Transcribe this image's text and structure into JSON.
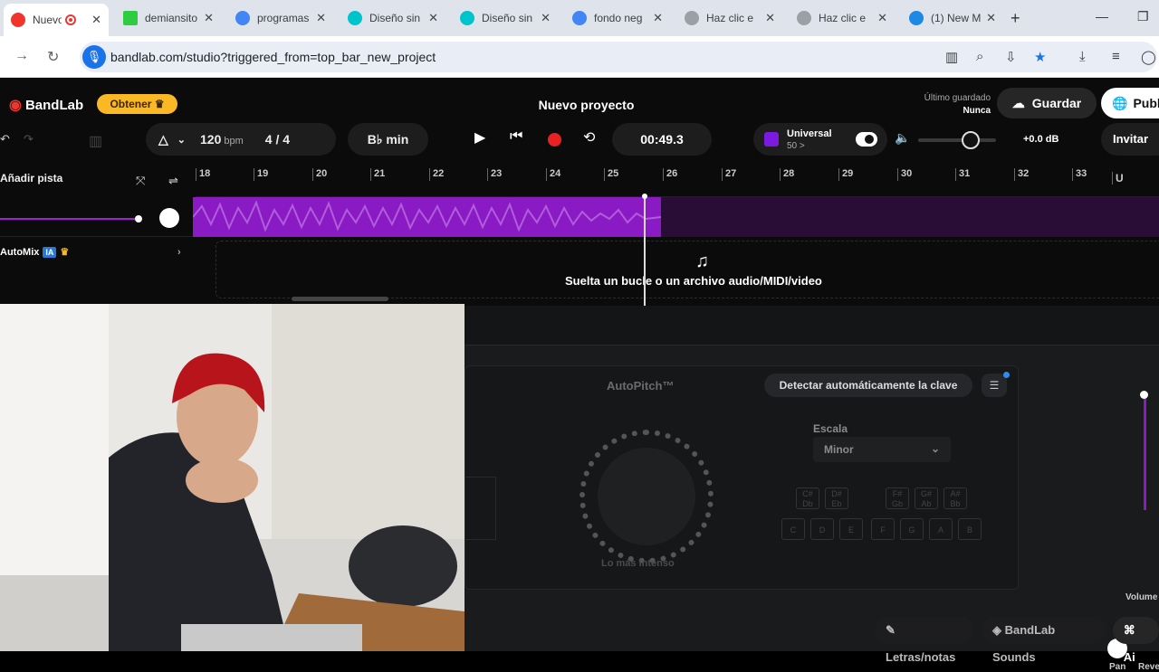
{
  "browser": {
    "tabs": [
      {
        "title": "Nuevo",
        "favicon_color": "#f0352d"
      },
      {
        "title": "demiansiton",
        "favicon_color": "#2ecc40"
      },
      {
        "title": "programas",
        "favicon_color": "#4285f4"
      },
      {
        "title": "Diseño sin",
        "favicon_color": "#00c4cc"
      },
      {
        "title": "Diseño sin",
        "favicon_color": "#00c4cc"
      },
      {
        "title": "fondo neg",
        "favicon_color": "#4285f4"
      },
      {
        "title": "Haz clic e",
        "favicon_color": "#9aa0a6"
      },
      {
        "title": "Haz clic e",
        "favicon_color": "#9aa0a6"
      },
      {
        "title": "(1) New M",
        "favicon_color": "#1e88e5"
      }
    ],
    "url": "bandlab.com/studio?triggered_from=top_bar_new_project"
  },
  "header": {
    "logo": "BandLab",
    "get_button": "Obtener",
    "project_title": "Nuevo proyecto",
    "last_saved_label": "Último guardado",
    "last_saved_value": "Nunca",
    "save_button": "Guardar",
    "publish_button": "Publ"
  },
  "toolbar": {
    "bpm": "120",
    "bpm_unit": "bpm",
    "time_sig": "4 / 4",
    "key": "B♭ min",
    "time": "00:49.3",
    "universal_label": "Universal",
    "universal_sub": "50 >",
    "master_db": "+0.0 dB",
    "invite_button": "Invitar"
  },
  "tracks": {
    "add_track": "Añadir pista",
    "ruler": [
      "18",
      "19",
      "20",
      "21",
      "22",
      "23",
      "24",
      "25",
      "26",
      "27",
      "28",
      "29",
      "30",
      "31",
      "32",
      "33"
    ],
    "automix_label": "AutoMix",
    "automix_badge": "IA",
    "drop_text": "Suelta un bucle o un archivo audio/MIDI/video"
  },
  "autopitch": {
    "title": "AutoPitch™",
    "detect_button": "Detectar automáticamente la clave",
    "scale_label": "Escala",
    "scale_value": "Minor",
    "dial_label": "Lo más intenso",
    "sharp_keys": [
      "C#\nDb",
      "D#\nEb",
      "F#\nGb",
      "G#\nAb",
      "A#\nBb"
    ],
    "natural_keys": [
      "C",
      "D",
      "E",
      "F",
      "G",
      "A",
      "B"
    ],
    "volume_label": "Volume",
    "pan_label": "Pan",
    "reverb_label": "Reve"
  },
  "bottom_bar": {
    "lyrics": "Letras/notas",
    "sounds": "BandLab Sounds",
    "extra": "Ai"
  },
  "colors": {
    "accent_purple": "#8a1ac4",
    "record_red": "#e82121",
    "get_yellow": "#f9b824"
  }
}
